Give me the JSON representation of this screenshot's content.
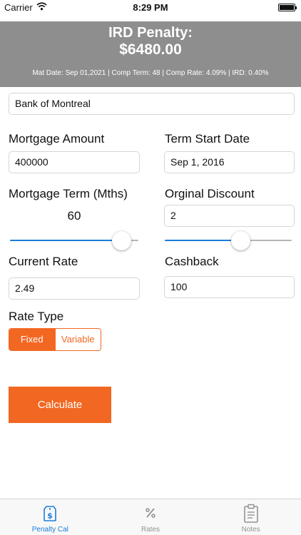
{
  "status_bar": {
    "carrier": "Carrier",
    "time": "8:29 PM"
  },
  "header": {
    "title": "IRD Penalty:",
    "value": "$6480.00",
    "summary": "Mat Date: Sep 01,2021 | Comp Term: 48 | Comp Rate: 4.09% | IRD: 0.40%"
  },
  "bank": {
    "value": "Bank of Montreal"
  },
  "mortgage_amount": {
    "label": "Mortgage Amount",
    "value": "400000"
  },
  "term_start_date": {
    "label": "Term Start Date",
    "value": "Sep 1, 2016"
  },
  "mortgage_term": {
    "label": "Mortgage Term (Mths)",
    "value": "60",
    "slider_level": 0.87
  },
  "original_discount": {
    "label": "Orginal Discount",
    "value": "2",
    "slider_level": 0.6
  },
  "current_rate": {
    "label": "Current Rate",
    "value": "2.49"
  },
  "cashback": {
    "label": "Cashback",
    "value": "100"
  },
  "rate_type": {
    "label": "Rate Type",
    "options": [
      "Fixed",
      "Variable"
    ],
    "selected": "Fixed"
  },
  "calculate": {
    "label": "Calculate"
  },
  "tabs": [
    {
      "label": "Penalty Cal",
      "icon": "dollar-tag-icon",
      "active": true
    },
    {
      "label": "Rates",
      "icon": "percent-icon",
      "active": false
    },
    {
      "label": "Notes",
      "icon": "clipboard-icon",
      "active": false
    }
  ],
  "colors": {
    "accent": "#f26722",
    "slider_fill": "#1a7dd8",
    "header_bg": "#8e8e8e",
    "tab_active": "#1a7dd8"
  }
}
